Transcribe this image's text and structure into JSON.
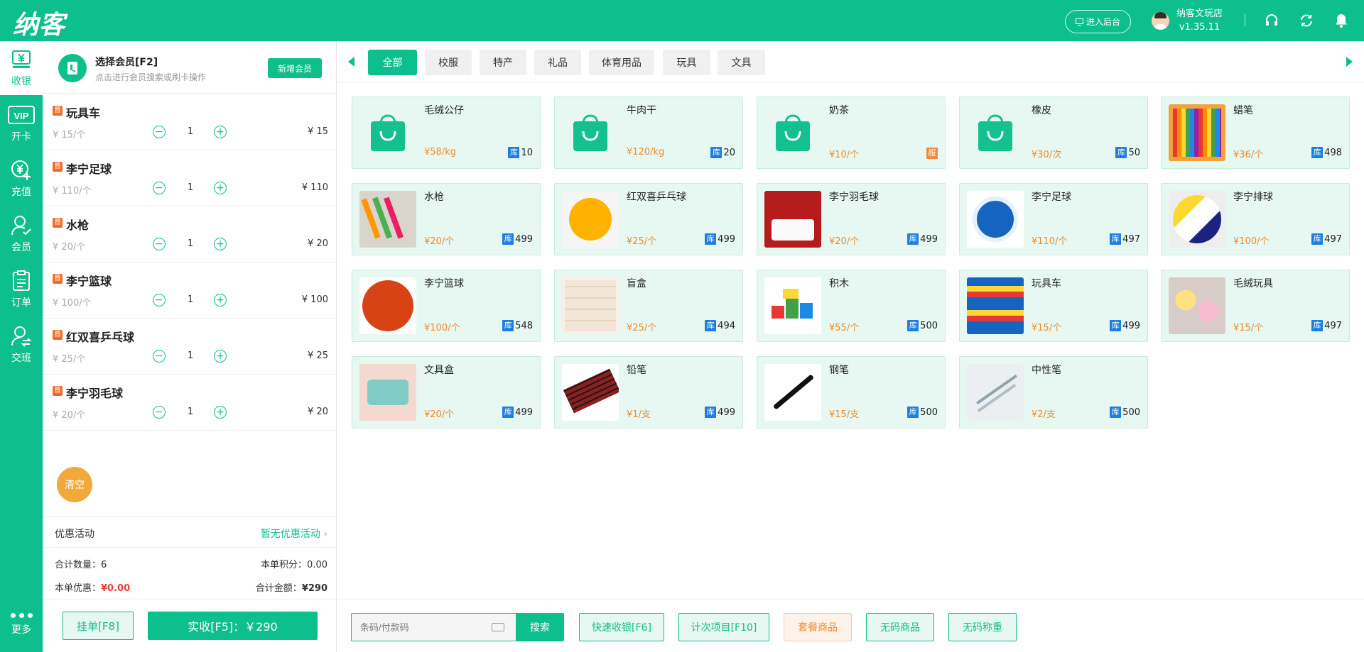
{
  "app": {
    "logo": "纳客",
    "admin_button": "进入后台",
    "shop_name": "纳客文玩店",
    "version": "v1.35.11",
    "accent_color": "#0dbf8c"
  },
  "sidenav": {
    "items": [
      {
        "label": "收银",
        "icon": "cashier-yen-icon"
      },
      {
        "label": "开卡",
        "icon": "vip-card-icon"
      },
      {
        "label": "充值",
        "icon": "recharge-icon"
      },
      {
        "label": "会员",
        "icon": "member-icon"
      },
      {
        "label": "订单",
        "icon": "order-clipboard-icon"
      },
      {
        "label": "交班",
        "icon": "shift-handover-icon"
      }
    ],
    "more": "更多"
  },
  "member": {
    "title": "选择会员[F2]",
    "subtitle": "点击进行会员搜索或刷卡操作",
    "add_button": "新增会员"
  },
  "cart": {
    "tag": "普",
    "items": [
      {
        "name": "玩具车",
        "unit_price": "¥ 15/个",
        "qty": "1",
        "total": "¥ 15"
      },
      {
        "name": "李宁足球",
        "unit_price": "¥ 110/个",
        "qty": "1",
        "total": "¥ 110"
      },
      {
        "name": "水枪",
        "unit_price": "¥ 20/个",
        "qty": "1",
        "total": "¥ 20"
      },
      {
        "name": "李宁篮球",
        "unit_price": "¥ 100/个",
        "qty": "1",
        "total": "¥ 100"
      },
      {
        "name": "红双喜乒乓球",
        "unit_price": "¥ 25/个",
        "qty": "1",
        "total": "¥ 25"
      },
      {
        "name": "李宁羽毛球",
        "unit_price": "¥ 20/个",
        "qty": "1",
        "total": "¥ 20"
      }
    ],
    "clear_button": "清空",
    "promo_label": "优惠活动",
    "promo_value": "暂无优惠活动",
    "total_qty_label": "合计数量：",
    "total_qty": "6",
    "points_label": "本单积分：",
    "points": "0.00",
    "discount_label": "本单优惠：",
    "discount": "¥0.00",
    "total_amount_label": "合计金额：",
    "total_amount": "¥290",
    "hold_button": "挂单[F8]",
    "pay_button": "实收[F5]：￥290"
  },
  "categories": [
    "全部",
    "校服",
    "特产",
    "礼品",
    "体育用品",
    "玩具",
    "文具"
  ],
  "stock_tag": "库",
  "service_tag": "服",
  "products": [
    {
      "name": "毛绒公仔",
      "price": "¥58/kg",
      "stock": "10",
      "img": "bag-icon"
    },
    {
      "name": "牛肉干",
      "price": "¥120/kg",
      "stock": "20",
      "img": "bag-icon"
    },
    {
      "name": "奶茶",
      "price": "¥10/个",
      "stock": "",
      "img": "bag-icon",
      "service": true
    },
    {
      "name": "橡皮",
      "price": "¥30/次",
      "stock": "50",
      "img": "bag-icon"
    },
    {
      "name": "蜡笔",
      "price": "¥36/个",
      "stock": "498",
      "img": "crayons-photo"
    },
    {
      "name": "水枪",
      "price": "¥20/个",
      "stock": "499",
      "img": "water-gun-photo"
    },
    {
      "name": "红双喜乒乓球",
      "price": "¥25/个",
      "stock": "499",
      "img": "ping-pong-ball-photo"
    },
    {
      "name": "李宁羽毛球",
      "price": "¥20/个",
      "stock": "499",
      "img": "shuttlecock-photo"
    },
    {
      "name": "李宁足球",
      "price": "¥110/个",
      "stock": "497",
      "img": "soccer-ball-photo"
    },
    {
      "name": "李宁排球",
      "price": "¥100/个",
      "stock": "497",
      "img": "volleyball-photo"
    },
    {
      "name": "李宁篮球",
      "price": "¥100/个",
      "stock": "548",
      "img": "basketball-photo"
    },
    {
      "name": "盲盒",
      "price": "¥25/个",
      "stock": "494",
      "img": "blind-box-photo"
    },
    {
      "name": "积木",
      "price": "¥55/个",
      "stock": "500",
      "img": "blocks-photo"
    },
    {
      "name": "玩具车",
      "price": "¥15/个",
      "stock": "499",
      "img": "toy-cars-photo"
    },
    {
      "name": "毛绒玩具",
      "price": "¥15/个",
      "stock": "497",
      "img": "plush-toys-photo"
    },
    {
      "name": "文具盒",
      "price": "¥20/个",
      "stock": "499",
      "img": "pencil-case-photo"
    },
    {
      "name": "铅笔",
      "price": "¥1/支",
      "stock": "499",
      "img": "pencils-photo"
    },
    {
      "name": "钢笔",
      "price": "¥15/支",
      "stock": "500",
      "img": "fountain-pen-photo"
    },
    {
      "name": "中性笔",
      "price": "¥2/支",
      "stock": "500",
      "img": "gel-pens-photo"
    }
  ],
  "bottom": {
    "search_placeholder": "条码/付款码",
    "search_button": "搜索",
    "buttons": [
      "快速收银[F6]",
      "计次项目[F10]",
      "套餐商品",
      "无码商品",
      "无码称重"
    ]
  }
}
